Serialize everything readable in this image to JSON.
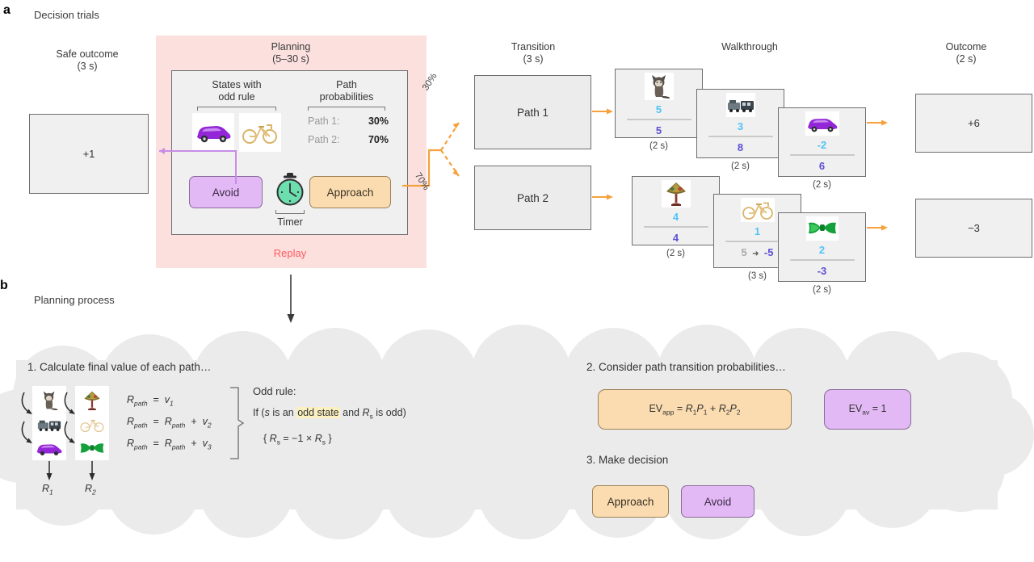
{
  "panels": {
    "a": {
      "letter": "a",
      "title": "Decision trials"
    },
    "b": {
      "letter": "b",
      "title": "Planning process"
    }
  },
  "stages": {
    "safe_outcome": {
      "label": "Safe outcome",
      "duration": "(3 s)",
      "value": "+1"
    },
    "planning": {
      "label": "Planning",
      "duration": "(5–30 s)",
      "states_header_line1": "States with",
      "states_header_line2": "odd rule",
      "prob_header_line1": "Path",
      "prob_header_line2": "probabilities",
      "odd_states": [
        "car-icon",
        "bicycle-icon"
      ],
      "probabilities": [
        {
          "label": "Path 1:",
          "value": "30%"
        },
        {
          "label": "Path 2:",
          "value": "70%"
        }
      ],
      "avoid_label": "Avoid",
      "approach_label": "Approach",
      "timer_label": "Timer",
      "timer_icon": "stopwatch-icon",
      "replay_label": "Replay"
    },
    "transition": {
      "label": "Transition",
      "duration": "(3 s)",
      "branch_labels": [
        "30%",
        "70%"
      ],
      "paths": [
        "Path 1",
        "Path 2"
      ]
    },
    "walkthrough": {
      "label": "Walkthrough",
      "path1": [
        {
          "icon": "cat-icon",
          "top": "5",
          "bottom": "5",
          "duration": "(2 s)"
        },
        {
          "icon": "train-icon",
          "top": "3",
          "bottom": "8",
          "duration": "(2 s)"
        },
        {
          "icon": "car-icon",
          "top": "-2",
          "bottom": "6",
          "duration": "(2 s)"
        }
      ],
      "path2": [
        {
          "icon": "lamp-icon",
          "top": "4",
          "bottom": "4",
          "duration": "(2 s)"
        },
        {
          "icon": "bicycle-icon",
          "top": "1",
          "bottom_old": "5",
          "bottom": "-5",
          "duration": "(3 s)"
        },
        {
          "icon": "bowtie-icon",
          "top": "2",
          "bottom": "-3",
          "duration": "(2 s)"
        }
      ]
    },
    "outcome": {
      "label": "Outcome",
      "duration": "(2 s)",
      "values": [
        "+6",
        "−3"
      ]
    }
  },
  "planning_process": {
    "step1": {
      "title": "1. Calculate final value of each path…",
      "path1_icons": [
        "cat-icon",
        "train-icon",
        "car-icon"
      ],
      "path2_icons": [
        "lamp-icon",
        "bicycle-icon",
        "bowtie-icon"
      ],
      "path1_result": "R",
      "path1_result_sub": "1",
      "path2_result": "R",
      "path2_result_sub": "2",
      "formulas": [
        {
          "lhs": "R",
          "lhs_sub": "path",
          "eq": "=",
          "rhs": "v",
          "rhs_sub": "1",
          "mid": "",
          "mid_sub": ""
        },
        {
          "lhs": "R",
          "lhs_sub": "path",
          "eq": "=",
          "mid": "R",
          "mid_sub": "path",
          "plus": "+",
          "rhs": "v",
          "rhs_sub": "2"
        },
        {
          "lhs": "R",
          "lhs_sub": "path",
          "eq": "=",
          "mid": "R",
          "mid_sub": "path",
          "plus": "+",
          "rhs": "v",
          "rhs_sub": "3"
        }
      ],
      "odd_rule_title": "Odd rule:",
      "odd_rule_line1_a": "If (",
      "odd_rule_line1_s": "s",
      "odd_rule_line1_b": " is an ",
      "odd_rule_highlight": "odd state",
      "odd_rule_line1_c": " and ",
      "odd_rule_line1_R": "R",
      "odd_rule_line1_Rsub": "s",
      "odd_rule_line1_d": " is odd)",
      "odd_rule_line2_a": "{ ",
      "odd_rule_line2_R": "R",
      "odd_rule_line2_Rsub": "s",
      "odd_rule_line2_b": " = −1 × ",
      "odd_rule_line2_R2": "R",
      "odd_rule_line2_R2sub": "s",
      "odd_rule_line2_c": " }"
    },
    "step2": {
      "title": "2. Consider path transition probabilities…",
      "ev_app": "EV",
      "ev_app_sub": "app",
      "ev_app_rest": " = R",
      "ev_app_formula": "EV_app = R₁P₁ + R₂P₂",
      "ev_av_formula": "EV_av = 1"
    },
    "step3": {
      "title": "3. Make decision",
      "approach_label": "Approach",
      "avoid_label": "Avoid"
    }
  },
  "colors": {
    "pink_region": "#fbe0de",
    "replay_red": "#ff5a5f",
    "approach_fill": "#fbdcb0",
    "avoid_fill": "#e3b9f5",
    "arrow_orange": "#f6a13c",
    "arrow_purple": "#c98ce8",
    "value_top_blue": "#4fc3f7",
    "value_bottom_purple": "#5b4fd6",
    "cloud_gray": "#ebebeb",
    "highlight_yellow": "#fbf0c0",
    "timer_green": "#6ddfae"
  }
}
